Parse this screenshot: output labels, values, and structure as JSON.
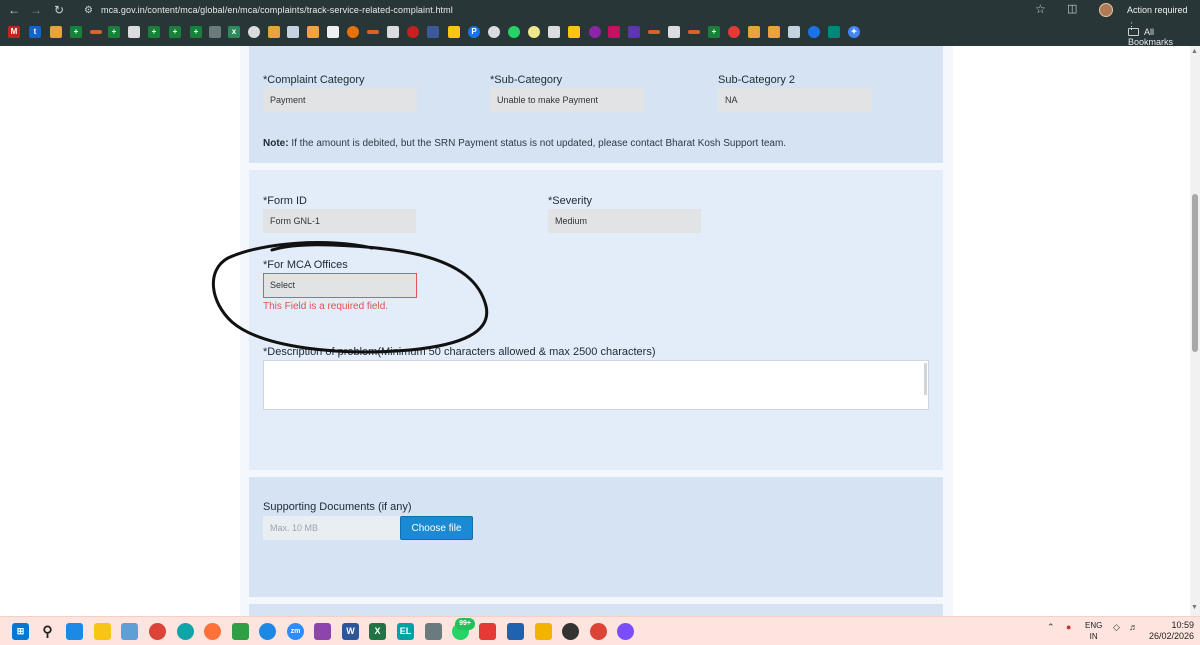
{
  "browser": {
    "url": "mca.gov.in/content/mca/global/en/mca/complaints/track-service-related-complaint.html",
    "action_label": "Action required",
    "all_bookmarks_label": "All Bookmarks",
    "url_icon": "site-info-icon",
    "colors": {
      "chrome": "#293638",
      "action": "#3a4648"
    }
  },
  "form": {
    "complaint_category": {
      "label": "*Complaint Category",
      "value": "Payment"
    },
    "sub_category": {
      "label": "*Sub-Category",
      "value": "Unable to make Payment"
    },
    "sub_category_2": {
      "label": "Sub-Category 2",
      "value": "NA"
    },
    "note": {
      "title": "Note:",
      "text": " If the amount is debited, but the SRN Payment status is not updated, please contact Bharat Kosh Support team."
    },
    "form_id": {
      "label": "*Form ID",
      "value": "Form GNL-1"
    },
    "severity": {
      "label": "*Severity",
      "value": "Medium"
    },
    "mca_offices": {
      "label": "*For MCA Offices",
      "value": "Select",
      "error": "This Field is a required field."
    },
    "description": {
      "label": "*Description of problem(Minimum 50 characters allowed & max 2500 characters)"
    },
    "supporting_docs": {
      "label": "Supporting Documents (if any)",
      "placeholder": "Max. 10 MB",
      "button": "Choose file"
    }
  },
  "taskbar": {
    "lang_line1": "ENG",
    "lang_line2": "IN",
    "time": "10:59",
    "date": "26/02/2026",
    "whatsapp_badge": "99+"
  }
}
